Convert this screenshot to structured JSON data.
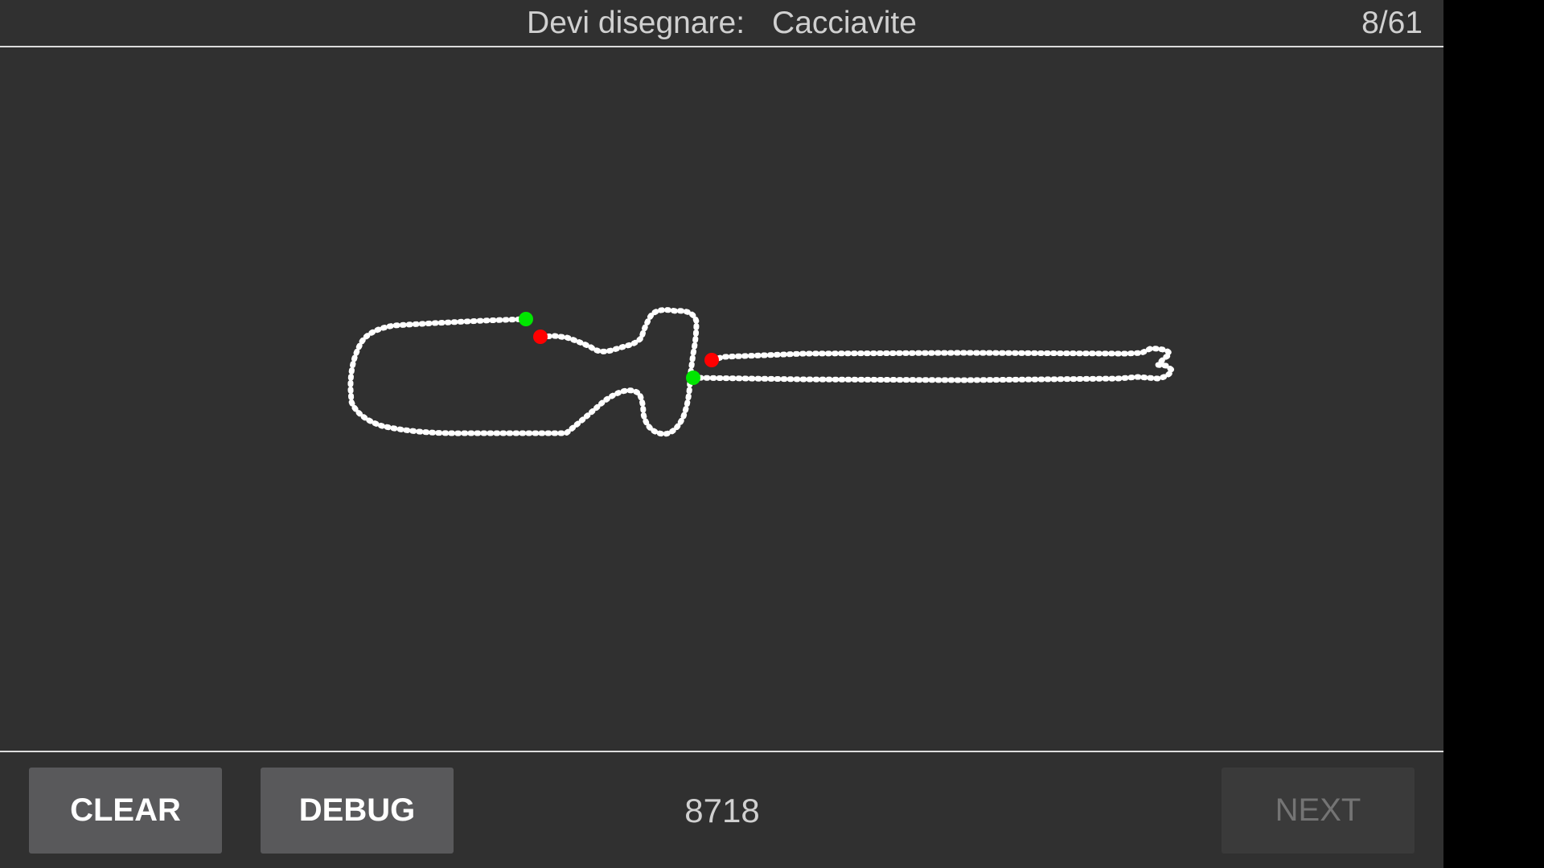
{
  "header": {
    "prompt_label": "Devi disegnare:",
    "target_word": "Cacciavite",
    "progress": "8/61"
  },
  "drawing": {
    "stroke_color": "#ffffff",
    "start_marker_color": "#00e600",
    "end_marker_color": "#ff0000"
  },
  "footer": {
    "clear_label": "CLEAR",
    "debug_label": "DEBUG",
    "score": "8718",
    "next_label": "NEXT"
  },
  "colors": {
    "background": "#303030",
    "button": "#59595b",
    "button_disabled": "#3a3a3a",
    "text": "#d0d0d0"
  }
}
